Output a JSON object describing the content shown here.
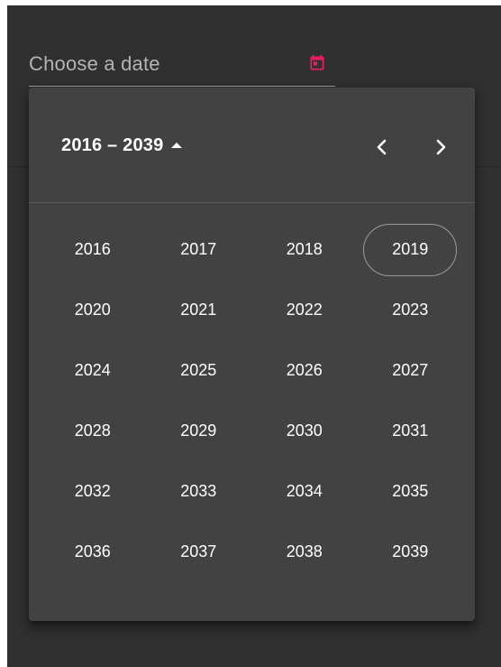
{
  "datepicker": {
    "input_placeholder": "Choose a date",
    "accent_color": "#e91e63",
    "panel": {
      "period_label": "2016 – 2039",
      "period_icon": "triangle-up-icon",
      "prev_icon": "chevron-left-icon",
      "next_icon": "chevron-right-icon",
      "years": [
        "2016",
        "2017",
        "2018",
        "2019",
        "2020",
        "2021",
        "2022",
        "2023",
        "2024",
        "2025",
        "2026",
        "2027",
        "2028",
        "2029",
        "2030",
        "2031",
        "2032",
        "2033",
        "2034",
        "2035",
        "2036",
        "2037",
        "2038",
        "2039"
      ],
      "highlighted_year": "2019"
    }
  }
}
